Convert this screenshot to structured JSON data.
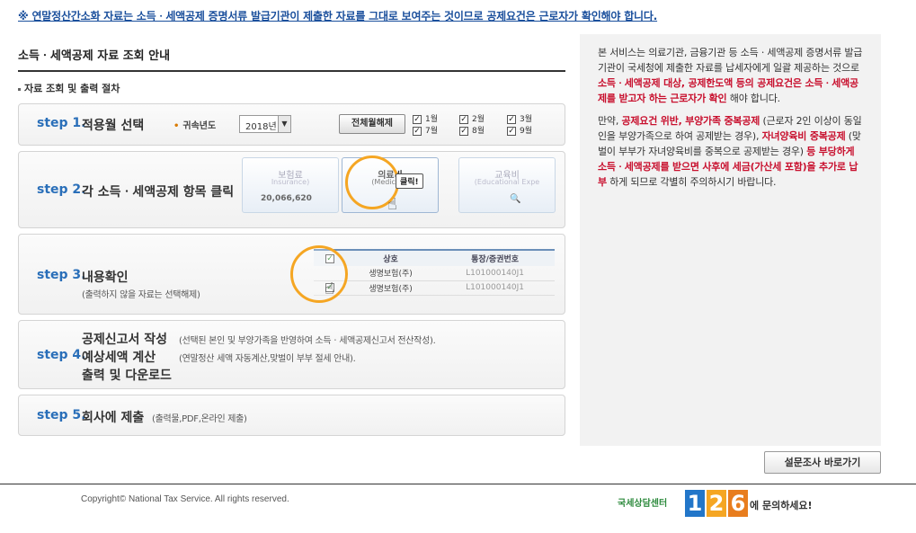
{
  "notice": "※ 연말정산간소화 자료는 소득ㆍ세액공제 증명서류 발급기관이 제출한 자료를 그대로 보여주는 것이므로 공제요건은 근로자가 확인해야 합니다.",
  "section_title": "소득ㆍ세액공제 자료 조회 안내",
  "procedure_title": "자료 조회 및 출력 절차",
  "step1": {
    "no": "step 1.",
    "name": "적용월 선택",
    "year_label": "귀속년도",
    "year_value": "2018년",
    "select_all": "전체월해제",
    "months": [
      "1월",
      "2월",
      "3월",
      "7월",
      "8월",
      "9월"
    ]
  },
  "step2": {
    "no": "step 2.",
    "name": "각 소득ㆍ세액공제 항목 클릭",
    "cards": [
      {
        "title": "보험료",
        "en": "Insurance)",
        "amount": "20,066,620"
      },
      {
        "title": "의료비",
        "en": "(Medical E"
      },
      {
        "title": "교육비",
        "en": "(Educational Expe"
      }
    ],
    "tooltip": "클릭!"
  },
  "step3": {
    "no": "step 3.",
    "name": "내용확인",
    "sub": "(출력하지 않을 자료는 선택해제)",
    "table": {
      "headers": [
        "상호",
        "통장/증권번호"
      ],
      "rows": [
        [
          "생명보험(주)",
          "L101000140J1"
        ],
        [
          "생명보험(주)",
          "L101000140J1"
        ]
      ]
    }
  },
  "step4": {
    "no": "step 4.",
    "line1": "공제신고서 작성",
    "line1_sub": "(선택된 본인 및 부양가족을 반영하여 소득ㆍ세액공제신고서 전산작성).",
    "line2": "예상세액 계산",
    "line2_sub": "(연말정산 세액 자동계산,맞벌이 부부 절세 안내).",
    "line3": "출력 및 다운로드"
  },
  "step5": {
    "no": "step 5.",
    "name": "회사에 제출",
    "sub": "(출력물,PDF,온라인 제출)"
  },
  "info": {
    "p1_a": "본 서비스는 의료기관, 금융기관 등 소득ㆍ세액공제 증명서류 발급기관이 국세청에 제출한 자료를 납세자에게 일괄 제공하는 것으로 ",
    "p1_red": "소득ㆍ세액공제 대상, 공제한도액 등의 공제요건은 소득ㆍ세액공제를 받고자 하는 근로자가 확인",
    "p1_b": " 해야 합니다.",
    "p2_a": "만약, ",
    "p2_red1": "공제요건 위반, 부양가족 중복공제",
    "p2_b": " (근로자 2인 이상이 동일인을 부양가족으로 하여 공제받는 경우), ",
    "p2_red2": "자녀양육비 중복공제",
    "p2_c": " (맞벌이 부부가 자녀양육비를 중복으로 공제받는 경우) ",
    "p2_red3": "등 부당하게 소득ㆍ세액공제를 받으면 사후에 세금(가산세 포함)을 추가로 납부",
    "p2_d": " 하게 되므로 각별히 주의하시기 바랍니다."
  },
  "survey_button": "설문조사 바로가기",
  "footer": {
    "copyright": "Copyright© National Tax Service. All rights reserved.",
    "center": "국세상담센터",
    "digits": [
      "1",
      "2",
      "6"
    ],
    "ask": "에 문의하세요!"
  }
}
